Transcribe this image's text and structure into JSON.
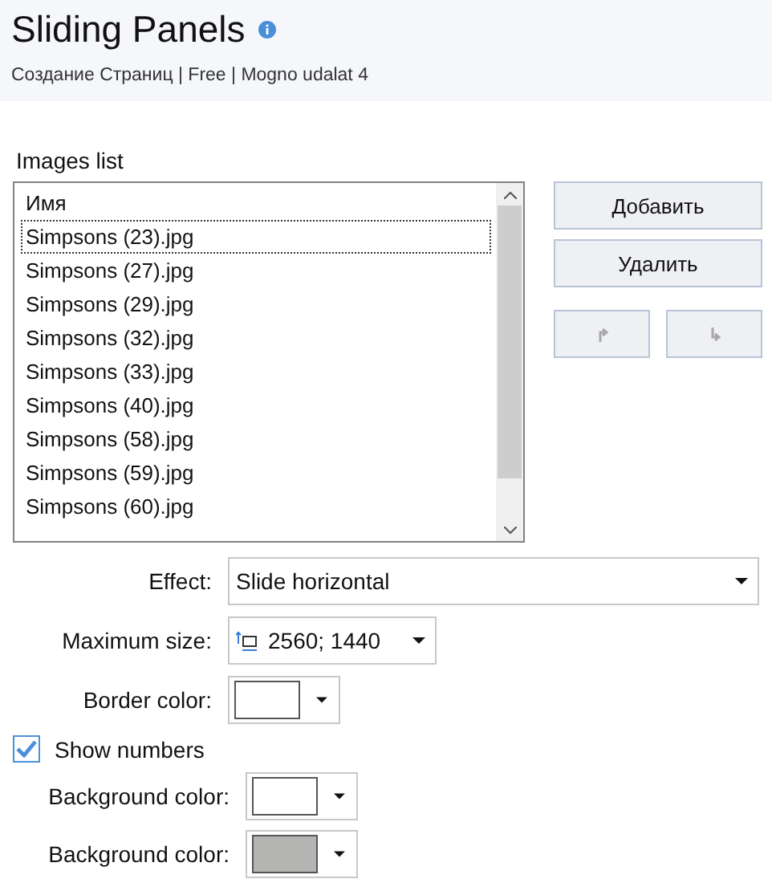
{
  "header": {
    "title": "Sliding Panels",
    "subtitle": "Создание Страниц | Free | Mogno udalat 4"
  },
  "images_list": {
    "label": "Images list",
    "column": "Имя",
    "rows": [
      {
        "name": "Simpsons (23).jpg",
        "selected": true
      },
      {
        "name": "Simpsons (27).jpg",
        "selected": false
      },
      {
        "name": "Simpsons (29).jpg",
        "selected": false
      },
      {
        "name": "Simpsons (32).jpg",
        "selected": false
      },
      {
        "name": "Simpsons (33).jpg",
        "selected": false
      },
      {
        "name": "Simpsons (40).jpg",
        "selected": false
      },
      {
        "name": "Simpsons (58).jpg",
        "selected": false
      },
      {
        "name": "Simpsons (59).jpg",
        "selected": false
      },
      {
        "name": "Simpsons (60).jpg",
        "selected": false
      }
    ]
  },
  "buttons": [
    {
      "label": "Добавить"
    },
    {
      "label": "Удалить"
    }
  ],
  "move_buttons": [
    {
      "kind": "up",
      "disabled": true
    },
    {
      "kind": "down",
      "disabled": true
    }
  ],
  "effect": {
    "label": "Effect:",
    "value": "Slide horizontal"
  },
  "max_size": {
    "label": "Maximum size:",
    "value": "2560; 1440"
  },
  "border_color": {
    "label": "Border color:",
    "color": "#ffffff"
  },
  "show_numbers": {
    "label": "Show numbers",
    "checked": true
  },
  "number_colors": [
    {
      "label": "Background color:",
      "color": "#ffffff"
    },
    {
      "label": "Background color:",
      "color": "#b4b5b3"
    }
  ]
}
